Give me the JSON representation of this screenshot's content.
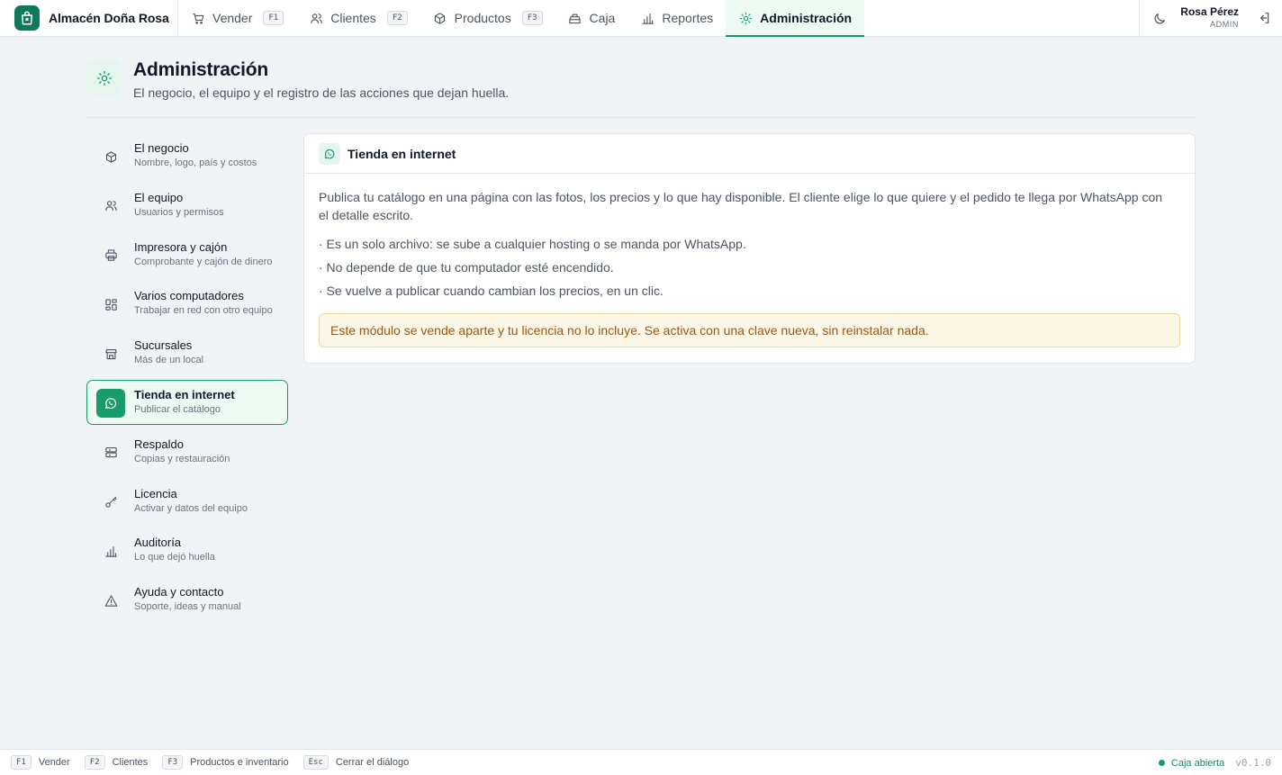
{
  "brand": {
    "name": "Almacén Doña Rosa",
    "icon": "shopping-bag-icon"
  },
  "nav": [
    {
      "label": "Vender",
      "key": "F1",
      "icon": "cart-icon",
      "active": false
    },
    {
      "label": "Clientes",
      "key": "F2",
      "icon": "users-icon",
      "active": false
    },
    {
      "label": "Productos",
      "key": "F3",
      "icon": "box-icon",
      "active": false
    },
    {
      "label": "Caja",
      "key": "",
      "icon": "cash-register-icon",
      "active": false
    },
    {
      "label": "Reportes",
      "key": "",
      "icon": "bar-chart-icon",
      "active": false
    },
    {
      "label": "Administración",
      "key": "",
      "icon": "sun-gear-icon",
      "active": true
    }
  ],
  "user": {
    "name": "Rosa Pérez",
    "role": "ADMIN"
  },
  "header": {
    "title": "Administración",
    "subtitle": "El negocio, el equipo y el registro de las acciones que dejan huella."
  },
  "side": [
    {
      "label": "El negocio",
      "sub": "Nombre, logo, país y costos",
      "icon": "box-icon"
    },
    {
      "label": "El equipo",
      "sub": "Usuarios y permisos",
      "icon": "users-icon"
    },
    {
      "label": "Impresora y cajón",
      "sub": "Comprobante y cajón de dinero",
      "icon": "printer-icon"
    },
    {
      "label": "Varios computadores",
      "sub": "Trabajar en red con otro equipo",
      "icon": "grid-icon"
    },
    {
      "label": "Sucursales",
      "sub": "Más de un local",
      "icon": "store-icon"
    },
    {
      "label": "Tienda en internet",
      "sub": "Publicar el catálogo",
      "icon": "whatsapp-icon",
      "active": true
    },
    {
      "label": "Respaldo",
      "sub": "Copias y restauración",
      "icon": "archive-icon"
    },
    {
      "label": "Licencia",
      "sub": "Activar y datos del equipo",
      "icon": "key-icon"
    },
    {
      "label": "Auditoría",
      "sub": "Lo que dejó huella",
      "icon": "bar-chart-icon"
    },
    {
      "label": "Ayuda y contacto",
      "sub": "Soporte, ideas y manual",
      "icon": "warning-icon"
    }
  ],
  "panel": {
    "title": "Tienda en internet",
    "icon": "whatsapp-icon",
    "description": "Publica tu catálogo en una página con las fotos, los precios y lo que hay disponible. El cliente elige lo que quiere y el pedido te llega por WhatsApp con el detalle escrito.",
    "bullets": [
      "· Es un solo archivo: se sube a cualquier hosting o se manda por WhatsApp.",
      "· No depende de que tu computador esté encendido.",
      "· Se vuelve a publicar cuando cambian los precios, en un clic."
    ],
    "notice": "Este módulo se vende aparte y tu licencia no lo incluye. Se activa con una clave nueva, sin reinstalar nada."
  },
  "statusbar": {
    "shortcuts": [
      {
        "key": "F1",
        "label": "Vender"
      },
      {
        "key": "F2",
        "label": "Clientes"
      },
      {
        "key": "F3",
        "label": "Productos e inventario"
      },
      {
        "key": "Esc",
        "label": "Cerrar el diálogo"
      }
    ],
    "status": "Caja abierta",
    "version": "v0.1.0"
  },
  "colors": {
    "accent": "#1a9b6c",
    "brand": "#0f7a5a",
    "notice_text": "#a3540a",
    "notice_bg": "#fdf7e8"
  }
}
